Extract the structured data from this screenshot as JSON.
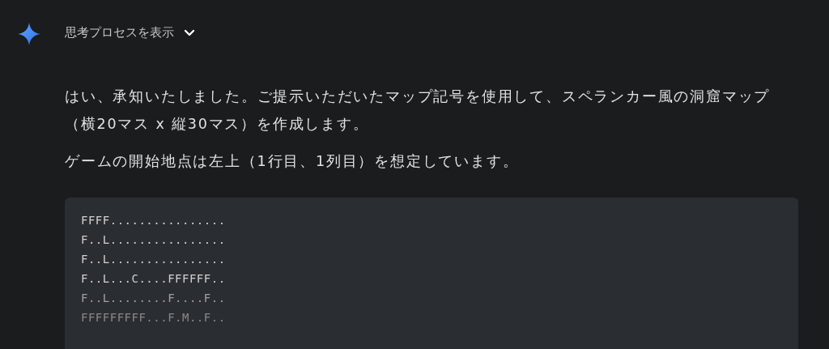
{
  "thoughts_toggle": {
    "label": "思考プロセスを表示",
    "expanded": false
  },
  "paragraphs": [
    "はい、承知いたしました。ご提示いただいたマップ記号を使用して、スペランカー風の洞窟マップ（横20マス x 縦30マス）を作成します。",
    "ゲームの開始地点は左上（1行目、1列目）を想定しています。"
  ],
  "code_lines": [
    "FFFF................",
    "F..L................",
    "F..L................",
    "F..L...C....FFFFFF..",
    "F..L........F....F..",
    "FFFFFFFFF...F.M..F.."
  ]
}
